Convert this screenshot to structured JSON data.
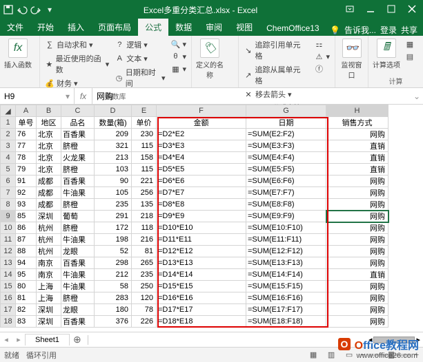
{
  "window": {
    "title": "Excel多重分类汇总.xlsx - Excel"
  },
  "tabs": {
    "file": "文件",
    "home": "开始",
    "insert": "插入",
    "layout": "页面布局",
    "formulas": "公式",
    "data": "数据",
    "review": "审阅",
    "view": "视图",
    "chemoffice": "ChemOffice13",
    "tellme": "告诉我...",
    "signin": "登录",
    "share": "共享"
  },
  "ribbon": {
    "insert_fn_btn": "插入函数",
    "fx_glyph": "fx",
    "autosum": "自动求和",
    "recent": "最近使用的函数",
    "financial": "财务",
    "logical": "逻辑",
    "text": "文本",
    "datetime": "日期和时间",
    "more_dd": "",
    "lib_label": "函数库",
    "define_name": "定义的名称",
    "trace_prec": "追踪引用单元格",
    "trace_dep": "追踪从属单元格",
    "remove_arrows": "移去箭头",
    "audit_label": "公式审核",
    "watch": "监视窗口",
    "calc_opts": "计算选项",
    "calc_label": "计算"
  },
  "fbar": {
    "namebox": "H9",
    "fx": "fx",
    "value": "网购"
  },
  "columns": [
    "A",
    "B",
    "C",
    "D",
    "E",
    "F",
    "G",
    "H"
  ],
  "headers": {
    "A": "单号",
    "B": "地区",
    "C": "品名",
    "D": "数量(箱)",
    "E": "单价",
    "F": "金额",
    "G": "日期",
    "H": "销售方式"
  },
  "rows": [
    {
      "n": 2,
      "A": "76",
      "B": "北京",
      "C": "百香果",
      "D": "209",
      "E": "230",
      "F": "=D2*E2",
      "G": "=SUM(E2:F2)",
      "H": "网购"
    },
    {
      "n": 3,
      "A": "77",
      "B": "北京",
      "C": "脐橙",
      "D": "321",
      "E": "115",
      "F": "=D3*E3",
      "G": "=SUM(E3:F3)",
      "H": "直销"
    },
    {
      "n": 4,
      "A": "78",
      "B": "北京",
      "C": "火龙果",
      "D": "213",
      "E": "158",
      "F": "=D4*E4",
      "G": "=SUM(E4:F4)",
      "H": "直销"
    },
    {
      "n": 5,
      "A": "79",
      "B": "北京",
      "C": "脐橙",
      "D": "103",
      "E": "115",
      "F": "=D5*E5",
      "G": "=SUM(E5:F5)",
      "H": "直销"
    },
    {
      "n": 6,
      "A": "91",
      "B": "成都",
      "C": "百香果",
      "D": "90",
      "E": "221",
      "F": "=D6*E6",
      "G": "=SUM(E6:F6)",
      "H": "网购"
    },
    {
      "n": 7,
      "A": "92",
      "B": "成都",
      "C": "牛油果",
      "D": "105",
      "E": "256",
      "F": "=D7*E7",
      "G": "=SUM(E7:F7)",
      "H": "网购"
    },
    {
      "n": 8,
      "A": "93",
      "B": "成都",
      "C": "脐橙",
      "D": "235",
      "E": "135",
      "F": "=D8*E8",
      "G": "=SUM(E8:F8)",
      "H": "网购"
    },
    {
      "n": 9,
      "A": "85",
      "B": "深圳",
      "C": "葡萄",
      "D": "291",
      "E": "218",
      "F": "=D9*E9",
      "G": "=SUM(E9:F9)",
      "H": "网购"
    },
    {
      "n": 10,
      "A": "86",
      "B": "杭州",
      "C": "脐橙",
      "D": "172",
      "E": "118",
      "F": "=D10*E10",
      "G": "=SUM(E10:F10)",
      "H": "网购"
    },
    {
      "n": 11,
      "A": "87",
      "B": "杭州",
      "C": "牛油果",
      "D": "198",
      "E": "216",
      "F": "=D11*E11",
      "G": "=SUM(E11:F11)",
      "H": "网购"
    },
    {
      "n": 12,
      "A": "88",
      "B": "杭州",
      "C": "龙眼",
      "D": "52",
      "E": "81",
      "F": "=D12*E12",
      "G": "=SUM(E12:F12)",
      "H": "网购"
    },
    {
      "n": 13,
      "A": "94",
      "B": "南京",
      "C": "百香果",
      "D": "298",
      "E": "265",
      "F": "=D13*E13",
      "G": "=SUM(E13:F13)",
      "H": "网购"
    },
    {
      "n": 14,
      "A": "95",
      "B": "南京",
      "C": "牛油果",
      "D": "212",
      "E": "235",
      "F": "=D14*E14",
      "G": "=SUM(E14:F14)",
      "H": "直销"
    },
    {
      "n": 15,
      "A": "80",
      "B": "上海",
      "C": "牛油果",
      "D": "58",
      "E": "250",
      "F": "=D15*E15",
      "G": "=SUM(E15:F15)",
      "H": "网购"
    },
    {
      "n": 16,
      "A": "81",
      "B": "上海",
      "C": "脐橙",
      "D": "283",
      "E": "120",
      "F": "=D16*E16",
      "G": "=SUM(E16:F16)",
      "H": "网购"
    },
    {
      "n": 17,
      "A": "82",
      "B": "深圳",
      "C": "龙眼",
      "D": "180",
      "E": "78",
      "F": "=D17*E17",
      "G": "=SUM(E17:F17)",
      "H": "网购"
    },
    {
      "n": 18,
      "A": "83",
      "B": "深圳",
      "C": "百香果",
      "D": "376",
      "E": "226",
      "F": "=D18*E18",
      "G": "=SUM(E18:F18)",
      "H": "网购"
    }
  ],
  "sheet": {
    "name": "Sheet1"
  },
  "status": {
    "ready": "就绪",
    "circular": "循环引用",
    "zoom_minus": "−",
    "zoom_plus": "+"
  },
  "watermark": {
    "brand_o": "O",
    "brand_rest": "ffice",
    "brand_suffix": "教程网",
    "url": "www.office26.com"
  },
  "selected": {
    "row": 9,
    "col": "H"
  }
}
